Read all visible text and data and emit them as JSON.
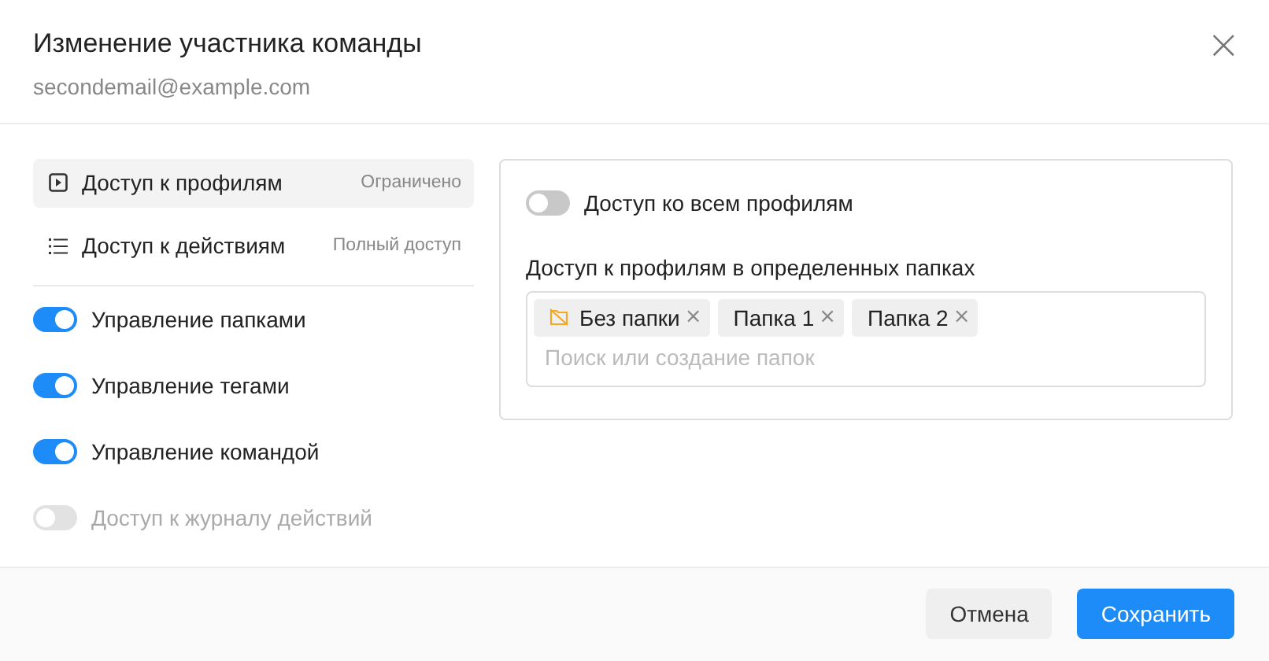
{
  "dialog": {
    "title": "Изменение участника команды",
    "subtitle": "secondemail@example.com",
    "close": "×"
  },
  "nav_items": [
    {
      "label": "Доступ к профилям",
      "value": "Ограничено",
      "kind": "profiles",
      "selected": true
    },
    {
      "label": "Доступ к действиям",
      "value": "Полный доступ",
      "kind": "actions",
      "selected": false
    }
  ],
  "toggles": [
    {
      "label": "Управление папками",
      "on": true,
      "disabled": false
    },
    {
      "label": "Управление тегами",
      "on": true,
      "disabled": false
    },
    {
      "label": "Управление командой",
      "on": true,
      "disabled": false
    },
    {
      "label": "Доступ к журналу действий",
      "on": false,
      "disabled": true
    }
  ],
  "panel": {
    "all_profiles": {
      "label": "Доступ ко всем профилям",
      "on": false
    },
    "folders_label": "Доступ к профилям в определенных папках",
    "chips": [
      {
        "label": "Без папки",
        "kind": "no-folder",
        "remove": "×"
      },
      {
        "label": "Папка 1",
        "kind": "folder",
        "remove": "×"
      },
      {
        "label": "Папка 2",
        "kind": "folder",
        "remove": "×"
      }
    ],
    "placeholder": "Поиск или создание папок"
  },
  "buttons": [
    {
      "label": "Отмена",
      "kind": "secondary"
    },
    {
      "label": "Сохранить",
      "kind": "primary"
    }
  ]
}
